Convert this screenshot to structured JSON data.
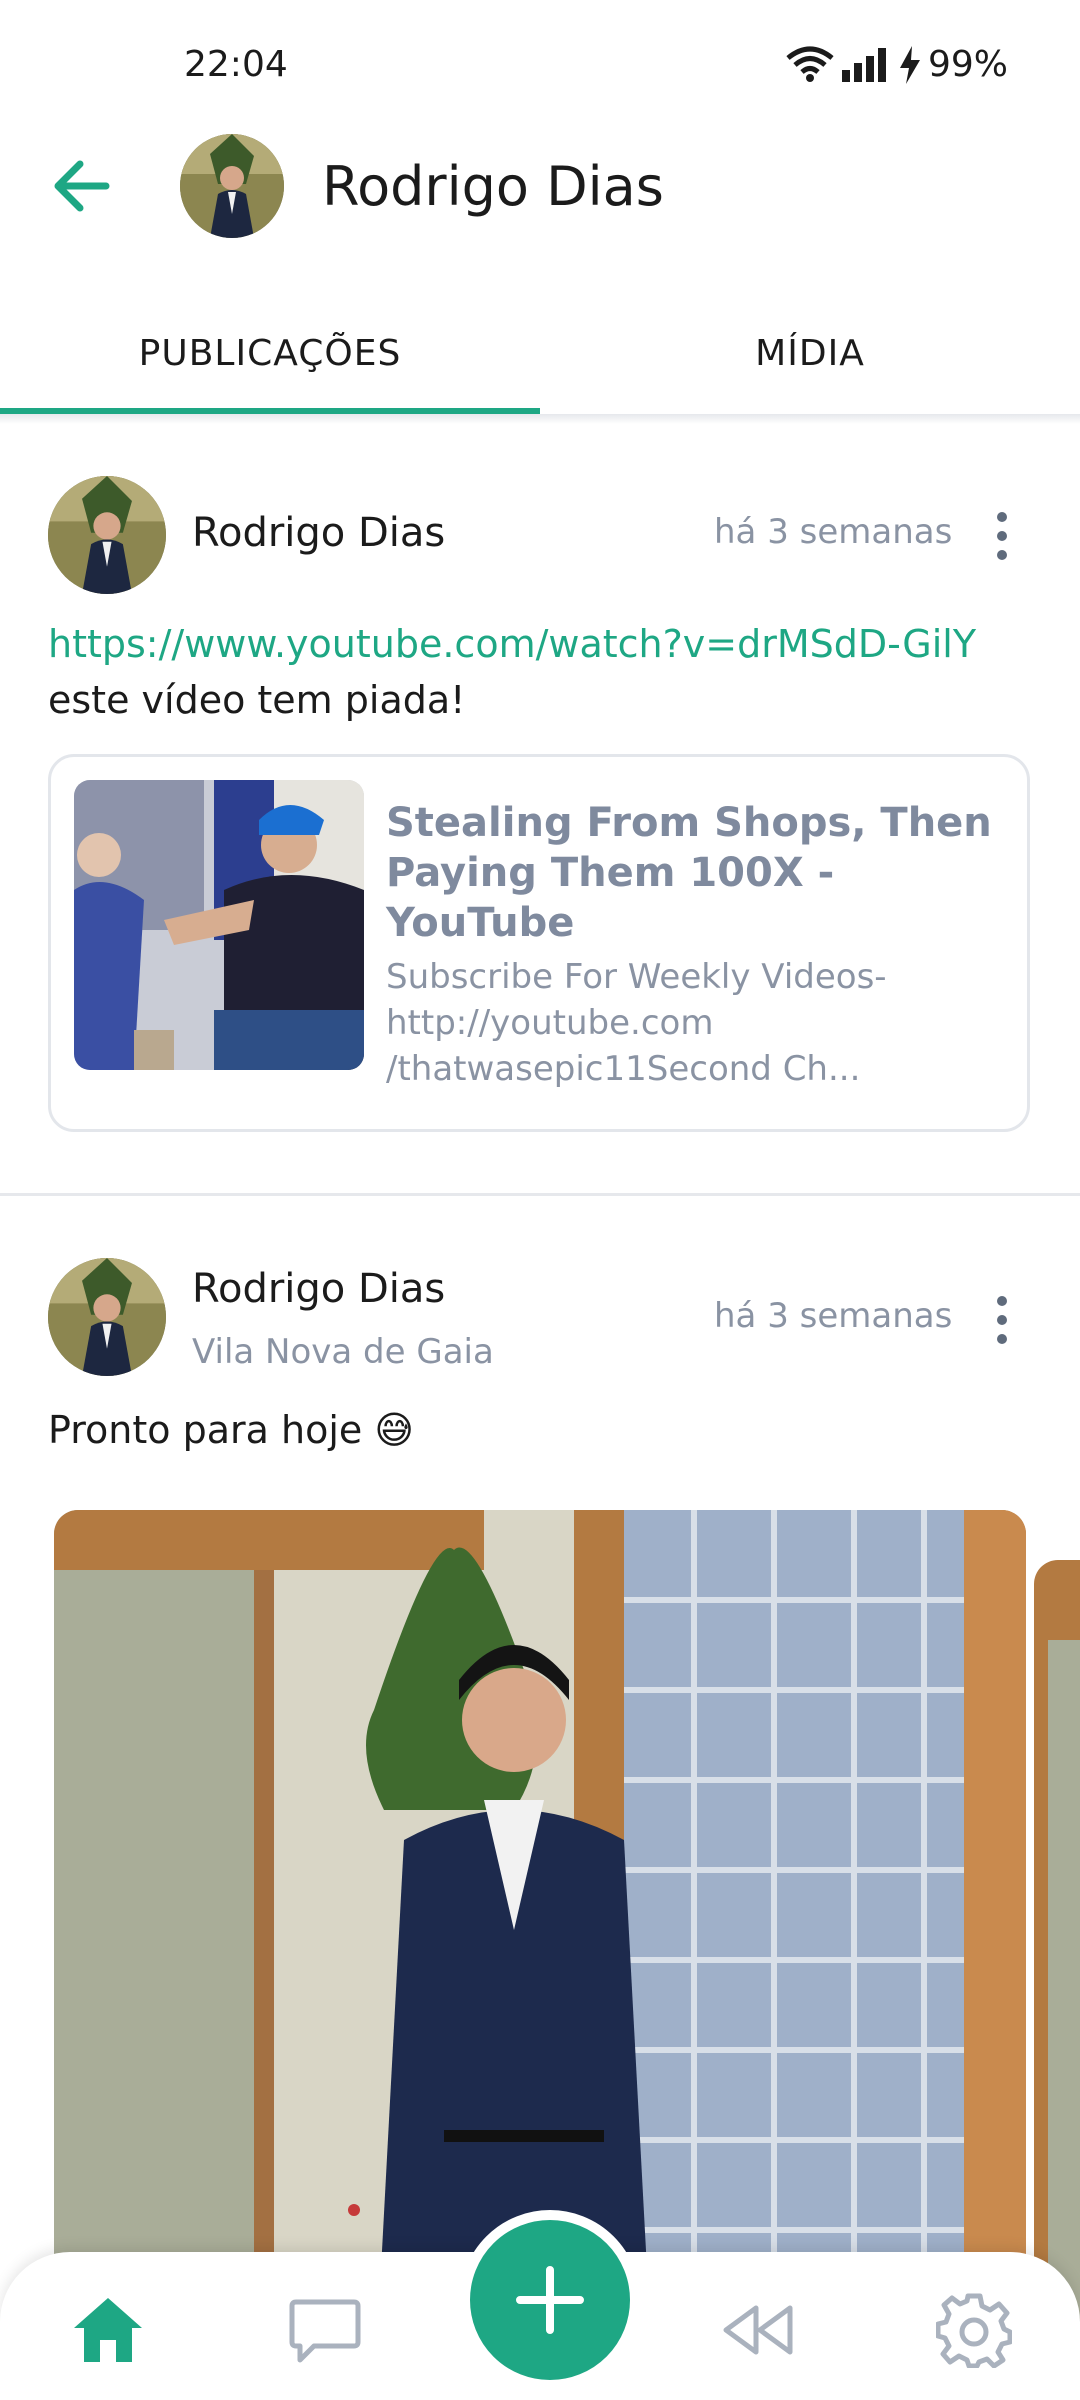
{
  "status": {
    "time": "22:04",
    "battery": "99%"
  },
  "header": {
    "title": "Rodrigo Dias"
  },
  "tabs": [
    {
      "label": "PUBLICAÇÕES"
    },
    {
      "label": "MÍDIA"
    }
  ],
  "posts": [
    {
      "author": "Rodrigo Dias",
      "time": "há 3 semanas",
      "link": "https://www.youtube.com/watch?v=drMSdD-GilY",
      "text": "este vídeo tem piada!",
      "preview": {
        "title": "Stealing From Shops, Then Paying Them 100X - YouTube",
        "description": "Subscribe For Weekly Videos- http://youtube.com /thatwasepic11Second Ch..."
      }
    },
    {
      "author": "Rodrigo Dias",
      "location": "Vila Nova de Gaia",
      "time": "há 3 semanas",
      "text": "Pronto para hoje 😅"
    }
  ],
  "nav": {
    "items": [
      "home-icon",
      "chat-icon",
      "rewind-icon",
      "gear-icon"
    ],
    "fab_icon": "plus-icon"
  },
  "colors": {
    "accent": "#1ea784",
    "muted": "#8a93a3"
  }
}
